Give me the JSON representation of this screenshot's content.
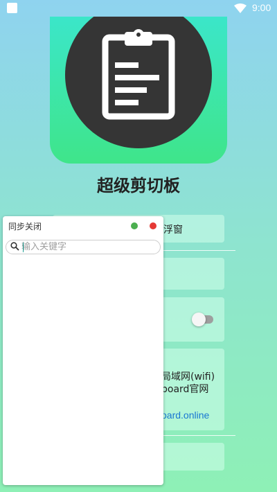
{
  "status_bar": {
    "time": "9:00"
  },
  "app": {
    "title": "超级剪切板"
  },
  "cards": {
    "floating_window_label": "浮窗",
    "lan_label": "局域网(wifi)",
    "official_site_label": "board官网",
    "url": "oard.online"
  },
  "float_window": {
    "sync_label": "同步关闭",
    "search_placeholder": "输入关键字",
    "status_colors": {
      "green": "#4caf50",
      "red": "#e53935"
    }
  },
  "icons": [
    "wifi-icon",
    "clipboard-icon",
    "search-icon"
  ]
}
